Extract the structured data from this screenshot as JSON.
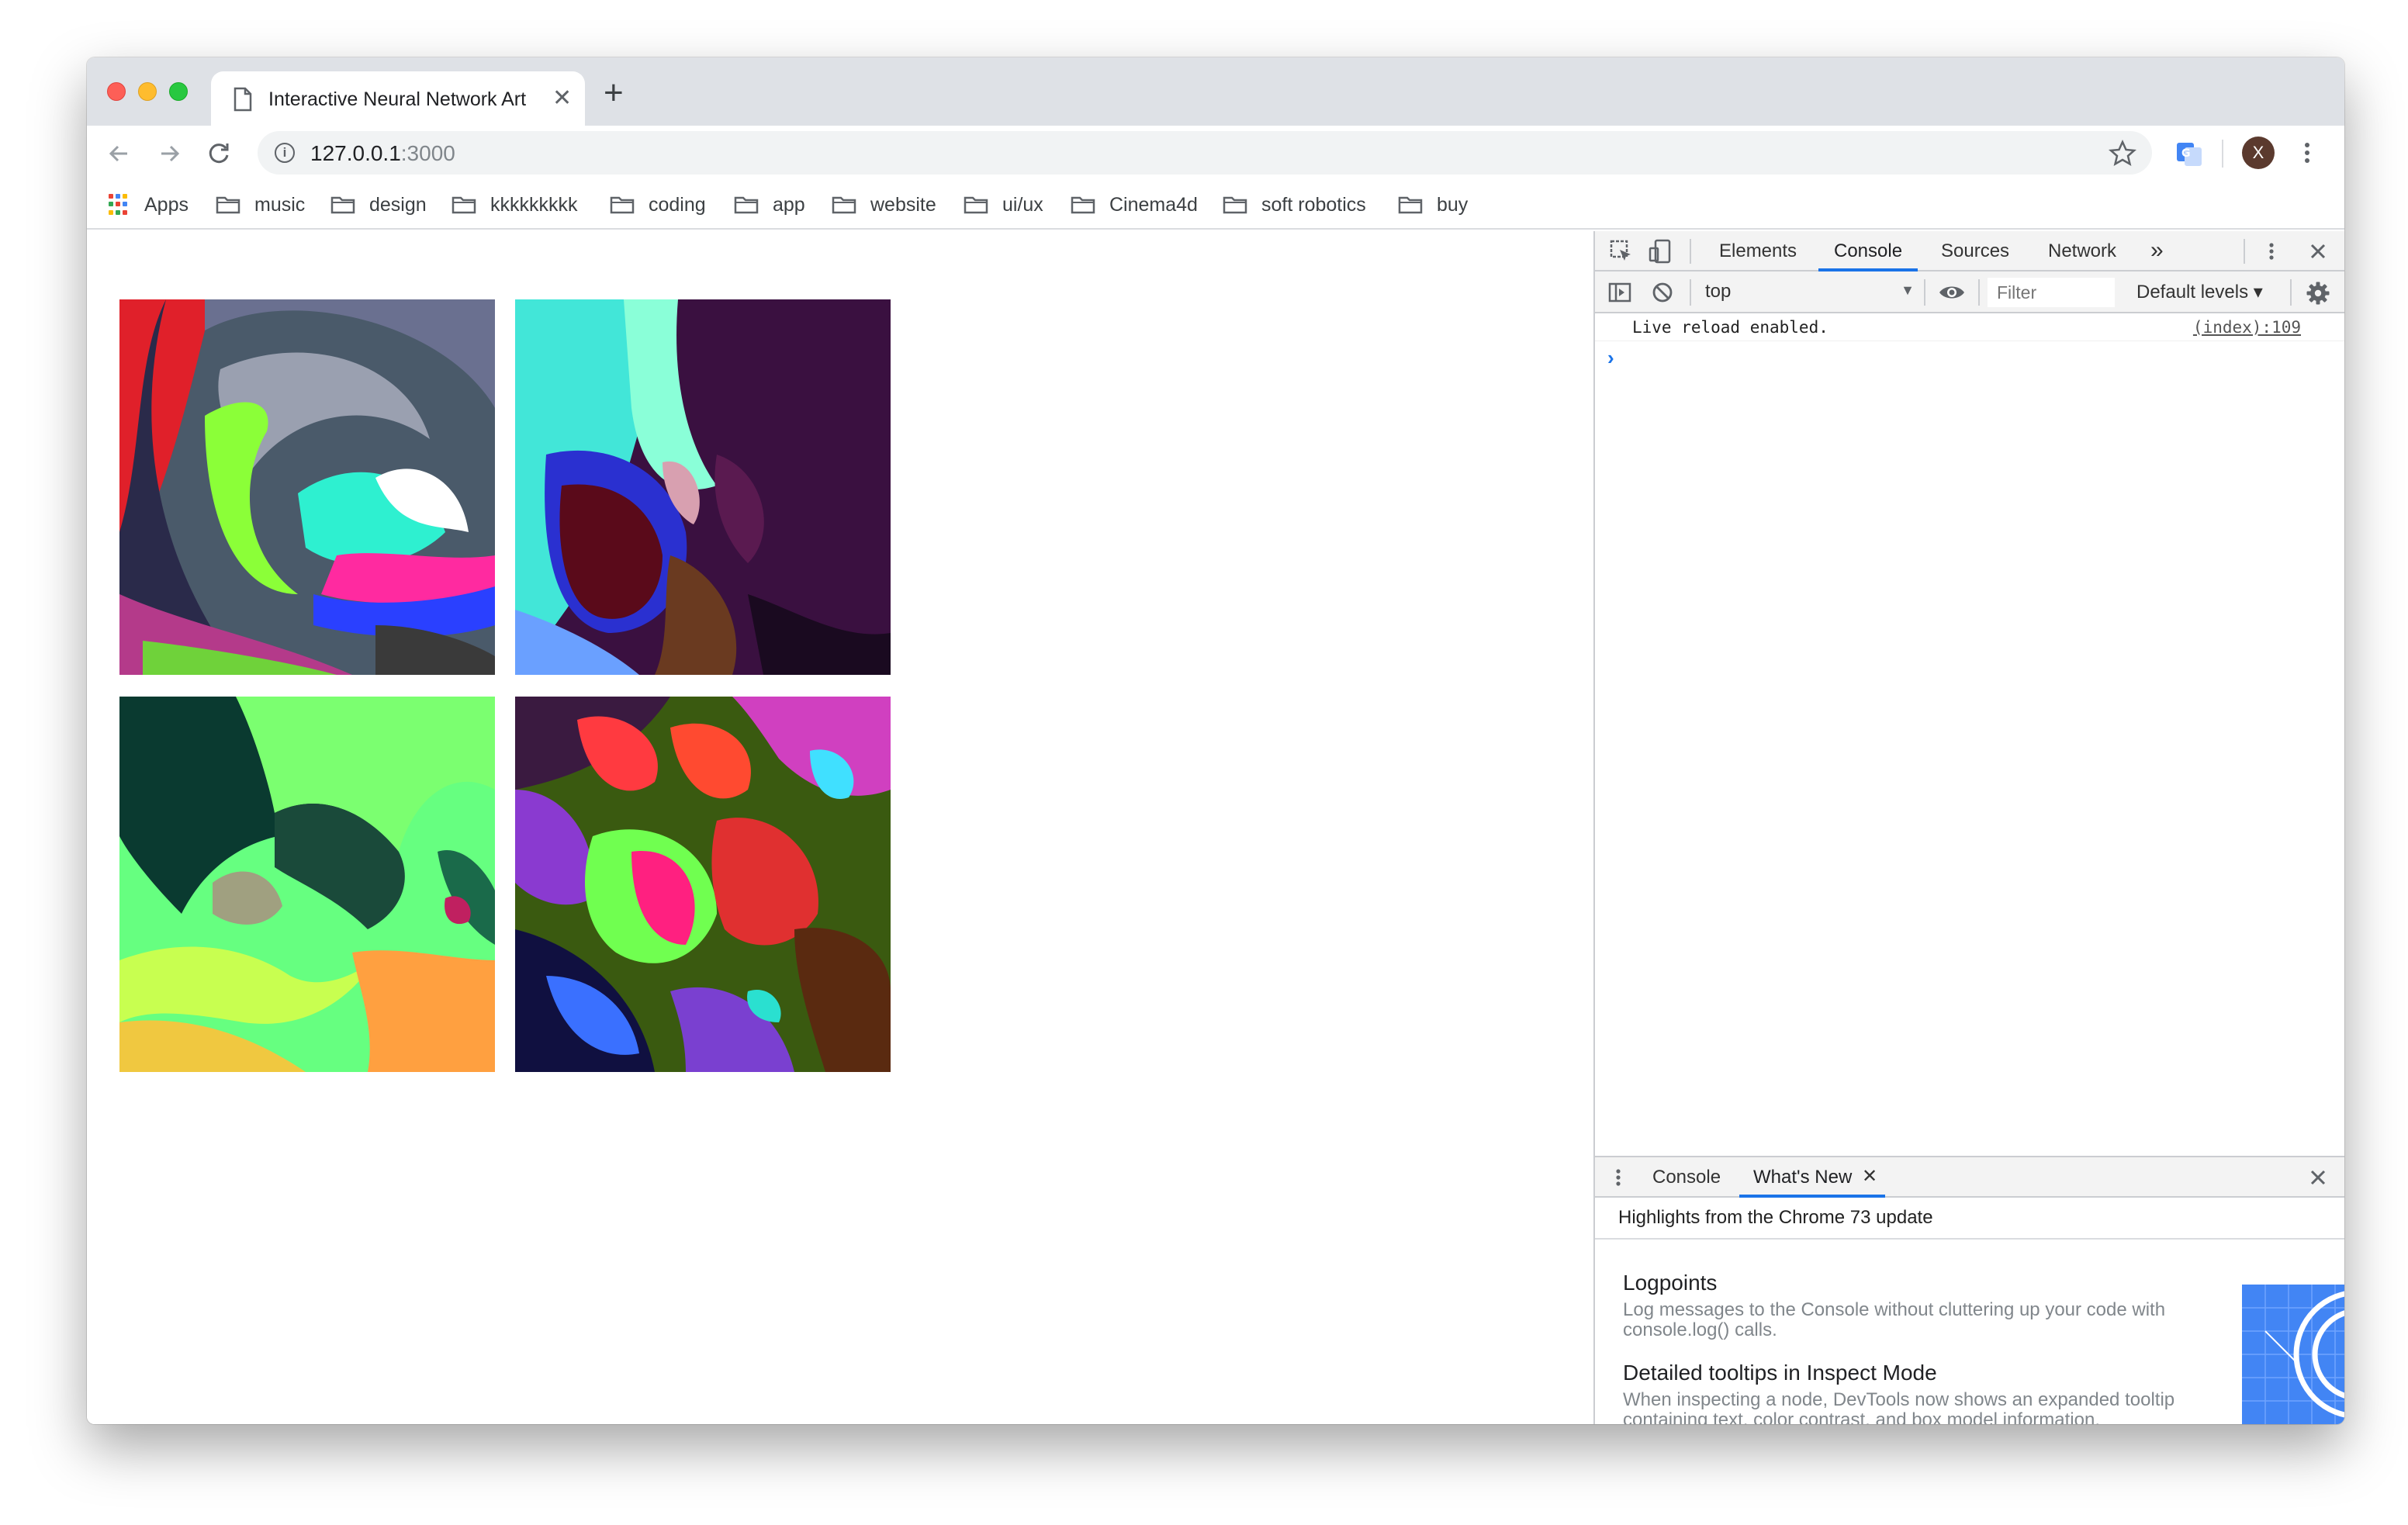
{
  "browser": {
    "tab": {
      "title": "Interactive Neural Network Art",
      "close": "✕"
    },
    "new_tab": "+",
    "url": {
      "host": "127.0.0.1",
      "port": ":3000"
    },
    "profile_initial": "X",
    "icons": {
      "back": "arrow-left-icon",
      "forward": "arrow-right-icon",
      "reload": "reload-icon",
      "info": "info-icon",
      "star": "star-icon",
      "translate": "translate-icon",
      "menu": "kebab-menu-icon"
    }
  },
  "bookmarks": {
    "apps_label": "Apps",
    "items": [
      {
        "label": "music"
      },
      {
        "label": "design"
      },
      {
        "label": "kkkkkkkkk"
      },
      {
        "label": "coding"
      },
      {
        "label": "app"
      },
      {
        "label": "website"
      },
      {
        "label": "ui/ux"
      },
      {
        "label": "Cinema4d"
      },
      {
        "label": "soft robotics"
      },
      {
        "label": "buy"
      }
    ]
  },
  "page": {
    "artworks": [
      {
        "name": "artwork-1"
      },
      {
        "name": "artwork-2"
      },
      {
        "name": "artwork-3"
      },
      {
        "name": "artwork-4"
      }
    ]
  },
  "devtools": {
    "tabs": [
      "Elements",
      "Console",
      "Sources",
      "Network"
    ],
    "active_tab": "Console",
    "more_tabs": "»",
    "context": "top",
    "filter_placeholder": "Filter",
    "levels": "Default levels ▾",
    "console_message": {
      "text": "Live reload enabled.",
      "source": "(index):109"
    },
    "prompt": "›",
    "drawer": {
      "tabs": [
        "Console",
        "What's New"
      ],
      "active_tab": "What's New",
      "tab_close": "✕",
      "heading": "Highlights from the Chrome 73 update",
      "items": [
        {
          "title": "Logpoints",
          "desc": "Log messages to the Console without cluttering up your code with console.log() calls."
        },
        {
          "title": "Detailed tooltips in Inspect Mode",
          "desc": "When inspecting a node, DevTools now shows an expanded tooltip containing text, color contrast, and box model information."
        }
      ]
    }
  },
  "colors": {
    "accent": "#1a73e8",
    "tab_strip": "#dee1e6",
    "devtools_bar": "#f3f3f3"
  }
}
